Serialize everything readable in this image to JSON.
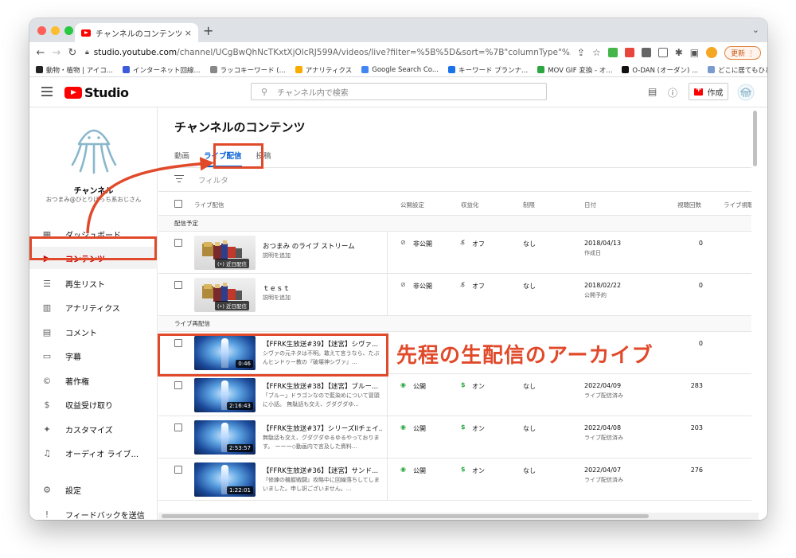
{
  "browser": {
    "tab_title": "チャンネルのコンテンツ - YouTube",
    "tab_close": "×",
    "new_tab": "+",
    "tab_menu": "⌄",
    "url_host": "studio.youtube.com",
    "url_path": "/channel/UCgBwQhNcTKxtXjOlcRJ599A/videos/live?filter=%5B%5D&sort=%7B\"columnType\"%3A\"date\"%2C\"sortOrder\"...",
    "update_label": "更新 ⋮",
    "bookmarks": [
      {
        "label": "動物・植物 | アイコ...",
        "color": "#222222"
      },
      {
        "label": "インターネット回線...",
        "color": "#3b5bdb"
      },
      {
        "label": "ラッコキーワード (...",
        "color": "#888888"
      },
      {
        "label": "アナリティクス",
        "color": "#f9ab00"
      },
      {
        "label": "Google Search Co...",
        "color": "#4285f4"
      },
      {
        "label": "キーワード プランナ...",
        "color": "#1a73e8"
      },
      {
        "label": "MOV GIF 変換 - オ...",
        "color": "#2ba640"
      },
      {
        "label": "O-DAN (オーダン) ...",
        "color": "#111111"
      },
      {
        "label": "どこに居てもひとり",
        "color": "#7a9ad0"
      }
    ],
    "bookmarks_more": "»"
  },
  "studio": {
    "logo_text": "Studio",
    "search_placeholder": "チャンネル内で検索",
    "create_label": "作成",
    "channel_label": "チャンネル",
    "channel_name": "おつまみ@ひとりぼっち系おじさん",
    "nav": [
      {
        "label": "ダッシュボード",
        "icon": "dashboard-icon",
        "glyph": "▦",
        "active": false
      },
      {
        "label": "コンテンツ",
        "icon": "content-icon",
        "glyph": "▶",
        "active": true
      },
      {
        "label": "再生リスト",
        "icon": "playlist-icon",
        "glyph": "☰",
        "active": false
      },
      {
        "label": "アナリティクス",
        "icon": "analytics-icon",
        "glyph": "▥",
        "active": false
      },
      {
        "label": "コメント",
        "icon": "comment-icon",
        "glyph": "▤",
        "active": false
      },
      {
        "label": "字幕",
        "icon": "subtitles-icon",
        "glyph": "▭",
        "active": false
      },
      {
        "label": "著作権",
        "icon": "copyright-icon",
        "glyph": "©",
        "active": false
      },
      {
        "label": "収益受け取り",
        "icon": "dollar-icon",
        "glyph": "$",
        "active": false
      },
      {
        "label": "カスタマイズ",
        "icon": "magic-wand-icon",
        "glyph": "✦",
        "active": false
      },
      {
        "label": "オーディオ ライブ...",
        "icon": "audio-library-icon",
        "glyph": "♫",
        "active": false
      },
      {
        "label": "設定",
        "icon": "gear-icon",
        "glyph": "⚙",
        "active": false
      },
      {
        "label": "フィードバックを送信",
        "icon": "feedback-icon",
        "glyph": "!",
        "active": false
      }
    ]
  },
  "content": {
    "page_title": "チャンネルのコンテンツ",
    "tabs": [
      {
        "label": "動画",
        "active": false
      },
      {
        "label": "ライブ配信",
        "active": true
      },
      {
        "label": "投稿",
        "active": false
      }
    ],
    "filter_label": "フィルタ",
    "columns": {
      "video": "ライブ配信",
      "visibility": "公開設定",
      "monetization": "収益化",
      "restrictions": "制限",
      "date": "日付",
      "views": "視聴回数",
      "live_viewers": "ライブ視聴者"
    },
    "sections": [
      {
        "label": "配信予定",
        "rows": [
          {
            "title": "おつまみ のライブ ストリーム",
            "desc": "説明を追加",
            "thumb": "sprite",
            "badge": "(•) 近日配信",
            "duration": "",
            "visibility": "非公開",
            "vis_icon": "eye-off-icon",
            "vis_glyph": "⊘",
            "monetization": "オフ",
            "mon_icon": "dollar-off-icon",
            "restriction": "なし",
            "date": "2018/04/13",
            "date_sub": "作成日",
            "views": "0"
          },
          {
            "title": "ｔｅｓｔ",
            "desc": "説明を追加",
            "thumb": "sprite",
            "badge": "(•) 近日配信",
            "duration": "",
            "visibility": "非公開",
            "vis_icon": "eye-off-icon",
            "vis_glyph": "⊘",
            "monetization": "オフ",
            "mon_icon": "dollar-off-icon",
            "restriction": "なし",
            "date": "2018/02/22",
            "date_sub": "公開予約",
            "views": "0"
          }
        ]
      },
      {
        "label": "ライブ再配信",
        "rows": [
          {
            "title": "【FFRK生放送#39】【迷宮】シヴァ...",
            "desc": "シヴァの元ネタは不明。敢えて言うなら、たぶんヒンドゥー教の『破壊神シヴァ』...",
            "thumb": "video",
            "badge": "",
            "duration": "0:46",
            "visibility": "",
            "vis_icon": "",
            "vis_glyph": "",
            "monetization": "",
            "mon_icon": "",
            "restriction": "",
            "date": "",
            "date_sub": "",
            "views": "0"
          },
          {
            "title": "【FFRK生放送#38】【迷宮】ブルー...",
            "desc": "「ブルー」ドラゴンなので藍染めについて冒頭に小話。 無駄話も交え、グダグダゆ...",
            "thumb": "video",
            "badge": "",
            "duration": "2:16:43",
            "visibility": "公開",
            "vis_icon": "eye-icon",
            "vis_glyph": "◉",
            "monetization": "オン",
            "mon_icon": "dollar-icon",
            "restriction": "なし",
            "date": "2022/04/09",
            "date_sub": "ライブ配信済み",
            "views": "283"
          },
          {
            "title": "【FFRK生放送#37】シリーズIIチェイ...",
            "desc": "無駄話も交え、グダグダゆるゆるやっております。 ーーー◇動画内で言及した資料...",
            "thumb": "video",
            "badge": "",
            "duration": "2:53:57",
            "visibility": "公開",
            "vis_icon": "eye-icon",
            "vis_glyph": "◉",
            "monetization": "オン",
            "mon_icon": "dollar-icon",
            "restriction": "なし",
            "date": "2022/04/08",
            "date_sub": "ライブ配信済み",
            "views": "203"
          },
          {
            "title": "【FFRK生放送#36】【迷宮】サンド...",
            "desc": "『修練の機握戦闘』攻略中に回線落ちしてしまいました。申し訳ございません。...",
            "thumb": "video",
            "badge": "",
            "duration": "1:22:01",
            "visibility": "公開",
            "vis_icon": "eye-icon",
            "vis_glyph": "◉",
            "monetization": "オン",
            "mon_icon": "dollar-icon",
            "restriction": "なし",
            "date": "2022/04/07",
            "date_sub": "ライブ配信済み",
            "views": "276"
          }
        ]
      }
    ]
  },
  "annotation": {
    "text": "先程の生配信のアーカイブ",
    "color": "#e04a2a"
  }
}
